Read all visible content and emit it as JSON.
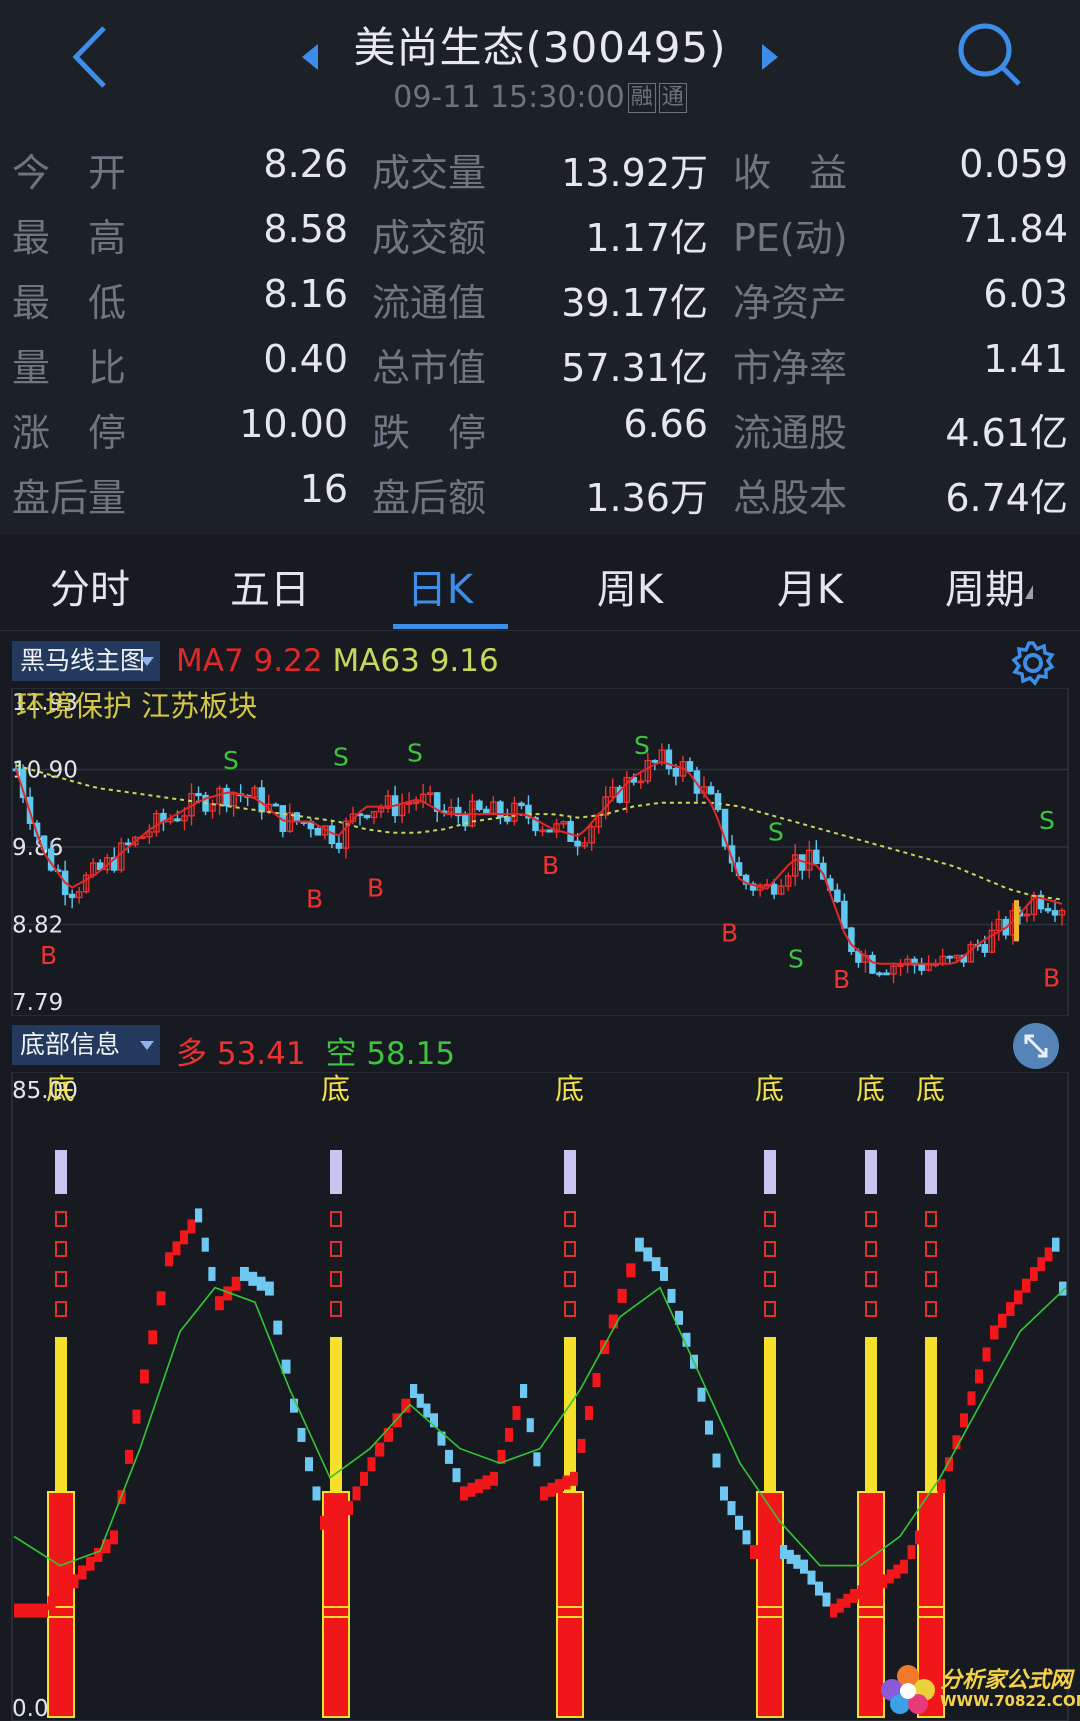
{
  "header": {
    "title": "美尚生态(300495)",
    "datetime": "09-11 15:30:00",
    "badge_margin": "融",
    "badge_connect": "通"
  },
  "quote": [
    [
      {
        "label": "今　开",
        "value": "8.26"
      },
      {
        "label": "成交量",
        "value": "13.92万"
      },
      {
        "label": "收　益",
        "value": "0.059"
      }
    ],
    [
      {
        "label": "最　高",
        "value": "8.58"
      },
      {
        "label": "成交额",
        "value": "1.17亿"
      },
      {
        "label": "PE(动)",
        "value": "71.84"
      }
    ],
    [
      {
        "label": "最　低",
        "value": "8.16"
      },
      {
        "label": "流通值",
        "value": "39.17亿"
      },
      {
        "label": "净资产",
        "value": "6.03"
      }
    ],
    [
      {
        "label": "量　比",
        "value": "0.40"
      },
      {
        "label": "总市值",
        "value": "57.31亿"
      },
      {
        "label": "市净率",
        "value": "1.41"
      }
    ],
    [
      {
        "label": "涨　停",
        "value": "10.00"
      },
      {
        "label": "跌　停",
        "value": "6.66"
      },
      {
        "label": "流通股",
        "value": "4.61亿"
      }
    ],
    [
      {
        "label": "盘后量",
        "value": "16"
      },
      {
        "label": "盘后额",
        "value": "1.36万"
      },
      {
        "label": "总股本",
        "value": "6.74亿"
      }
    ]
  ],
  "tabs": [
    "分时",
    "五日",
    "日K",
    "周K",
    "月K",
    "周期"
  ],
  "active_tab": "日K",
  "main_chart": {
    "selector": "黑马线主图",
    "ma7_label": "MA7",
    "ma7_value": "9.22",
    "ma63_label": "MA63",
    "ma63_value": "9.16",
    "overlay_text": "环境保护 江苏板块",
    "y_ticks": [
      "11.93",
      "10.90",
      "9.86",
      "8.82",
      "7.79"
    ],
    "signals_s": "S",
    "signals_b": "B"
  },
  "sub_chart": {
    "selector": "底部信息",
    "duo_label": "多",
    "duo_value": "53.41",
    "kong_label": "空",
    "kong_value": "58.15",
    "y_top": "85.00",
    "y_bottom": "0.00",
    "bottom_label": "底",
    "bottom_markers": 6
  },
  "chart_data": {
    "type": "candlestick",
    "ylim": [
      7.79,
      11.93
    ],
    "ma7_approx": [
      10.9,
      9.8,
      9.3,
      9.5,
      9.8,
      10.1,
      10.3,
      10.5,
      10.6,
      10.5,
      10.2,
      10.2,
      10.0,
      10.4,
      10.4,
      10.5,
      10.3,
      10.3,
      10.3,
      10.3,
      10.1,
      10.0,
      10.4,
      10.8,
      11.0,
      10.9,
      10.4,
      9.4,
      9.3,
      9.7,
      9.6,
      8.6,
      8.3,
      8.3,
      8.3,
      8.3,
      8.6,
      8.8,
      9.2,
      9.1
    ],
    "ma63_approx": [
      10.95,
      10.85,
      10.75,
      10.65,
      10.6,
      10.55,
      10.5,
      10.45,
      10.4,
      10.35,
      10.3,
      10.25,
      10.2,
      10.1,
      10.05,
      10.05,
      10.1,
      10.2,
      10.25,
      10.3,
      10.3,
      10.25,
      10.3,
      10.4,
      10.45,
      10.45,
      10.45,
      10.4,
      10.3,
      10.2,
      10.1,
      10.0,
      9.9,
      9.8,
      9.7,
      9.6,
      9.45,
      9.3,
      9.2,
      9.16
    ],
    "sub_ylim": [
      0,
      85
    ]
  },
  "watermark": {
    "line1": "分析家公式网",
    "line2": "WWW.70822.COM"
  },
  "colors": {
    "up": "#f0312f",
    "down": "#5fc8f0",
    "ma7": "#e02828",
    "ma63": "#c8d85a",
    "accent": "#3e8de8",
    "duo": "#f0312f",
    "kong": "#3ec43e",
    "bottom_text": "#f2e04a"
  }
}
